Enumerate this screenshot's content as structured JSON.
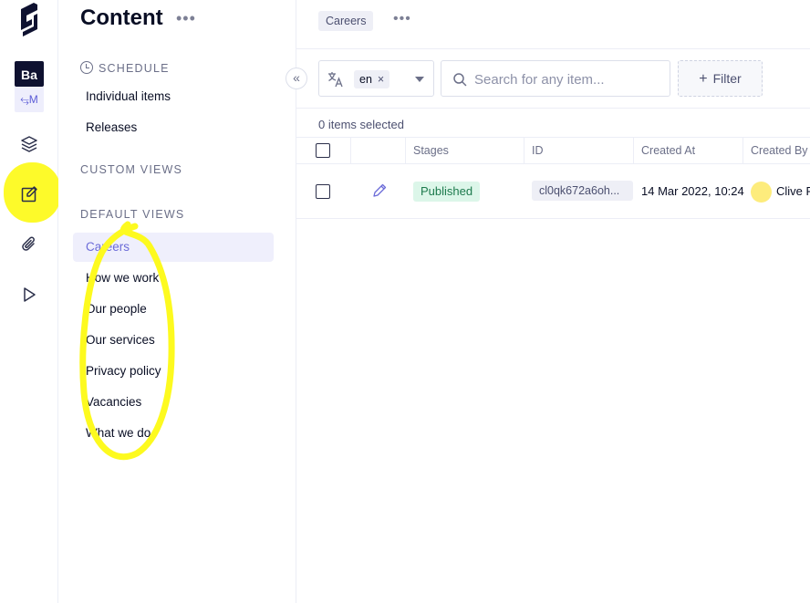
{
  "rail": {
    "project_initials": "Ba",
    "env_label": "M",
    "icons": [
      "logo-icon",
      "layers-icon",
      "edit-content-icon",
      "paperclip-icon",
      "play-icon"
    ]
  },
  "sidebar": {
    "title": "Content",
    "more": "•••",
    "schedule_heading": "SCHEDULE",
    "schedule_items": [
      "Individual items",
      "Releases"
    ],
    "custom_views_heading": "CUSTOM VIEWS",
    "default_views_heading": "DEFAULT VIEWS",
    "default_views": [
      "Careers",
      "How we work",
      "Our people",
      "Our services",
      "Privacy policy",
      "Vacancies",
      "What we do"
    ],
    "active_view": "Careers"
  },
  "main": {
    "tab_label": "Careers",
    "tab_more": "•••",
    "locale": {
      "value": "en",
      "remove": "×"
    },
    "search": {
      "placeholder": "Search for any item..."
    },
    "filter": {
      "plus": "+",
      "label": "Filter"
    },
    "selection_text": "0 items selected",
    "columns": [
      "Stages",
      "ID",
      "Created At",
      "Created By"
    ],
    "rows": [
      {
        "stage": "Published",
        "id": "cl0qk672a6oh...",
        "created_at": "14 Mar 2022, 10:24",
        "created_by": "Clive R"
      }
    ]
  },
  "collapse_label": "«",
  "colors": {
    "accent": "#6b6bd8",
    "highlight": "#fdfa1f",
    "published_bg": "#dcf6e9",
    "published_fg": "#1d7a4d"
  }
}
